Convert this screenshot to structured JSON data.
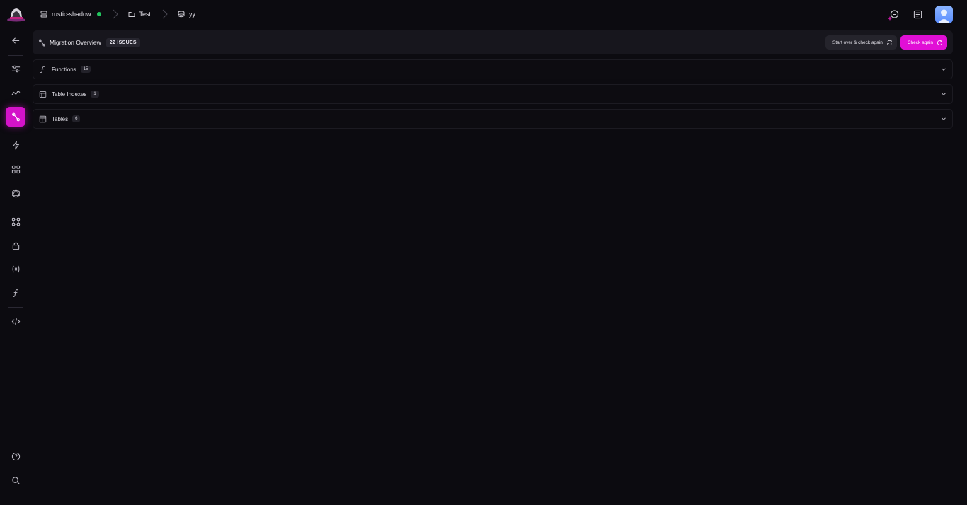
{
  "breadcrumb": {
    "project": "rustic-shadow",
    "folder": "Test",
    "database": "yy"
  },
  "colors": {
    "accent": "#e10fd6",
    "status_online": "#22c55e",
    "background": "#0c0b10"
  },
  "sidebar": {
    "items": [
      {
        "name": "back",
        "icon": "arrow-left-icon"
      },
      {
        "name": "settings",
        "icon": "sliders-icon"
      },
      {
        "name": "monitoring",
        "icon": "activity-icon"
      },
      {
        "name": "migration",
        "icon": "migration-icon",
        "active": true
      },
      {
        "name": "triggers",
        "icon": "bolt-icon"
      },
      {
        "name": "extensions",
        "icon": "grid-icon"
      },
      {
        "name": "graphql",
        "icon": "graphql-icon"
      },
      {
        "name": "integrations",
        "icon": "nodes-icon"
      },
      {
        "name": "security",
        "icon": "lock-icon"
      },
      {
        "name": "variables",
        "icon": "variables-icon"
      },
      {
        "name": "functions",
        "icon": "function-icon"
      },
      {
        "name": "api",
        "icon": "code-icon"
      },
      {
        "name": "help",
        "icon": "help-icon"
      },
      {
        "name": "search",
        "icon": "search-icon"
      }
    ]
  },
  "overview": {
    "title": "Migration Overview",
    "issues_badge": "22 ISSUES",
    "start_over_label": "Start over & check again",
    "check_again_label": "Check again"
  },
  "sections": [
    {
      "label": "Functions",
      "count": "15",
      "icon": "function-icon"
    },
    {
      "label": "Table Indexes",
      "count": "1",
      "icon": "index-icon"
    },
    {
      "label": "Tables",
      "count": "6",
      "icon": "table-icon"
    }
  ]
}
